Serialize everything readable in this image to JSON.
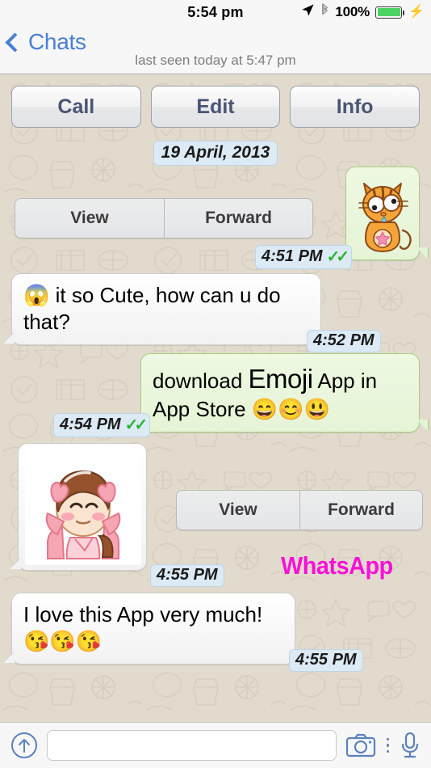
{
  "status_bar": {
    "time": "5:54 pm",
    "battery_percent": "100%",
    "location_icon": "location-arrow-icon",
    "bluetooth_icon": "bluetooth-icon",
    "battery_icon": "battery-full-icon",
    "charging_icon": "charging-bolt-icon",
    "battery_color": "#4cd363"
  },
  "nav": {
    "back_label": "Chats",
    "back_icon": "chevron-left-icon",
    "subtitle": "last seen today at 5:47 pm",
    "accent_color": "#4a7fd4"
  },
  "actions": [
    {
      "label": "Call",
      "name": "call-button"
    },
    {
      "label": "Edit",
      "name": "edit-button"
    },
    {
      "label": "Info",
      "name": "info-button"
    }
  ],
  "date_divider": "19 April, 2013",
  "segmented": {
    "view_label": "View",
    "forward_label": "Forward"
  },
  "messages": [
    {
      "id": "msg-cat-sticker",
      "direction": "outgoing",
      "type": "sticker",
      "sticker": "crying-cat-sticker",
      "time": "4:51 PM",
      "ticks": "✓✓",
      "has_segmented_control": true
    },
    {
      "id": "msg-so-cute",
      "direction": "incoming",
      "type": "text",
      "emoji_lead": "😱",
      "text": "it so Cute, how can u do that?",
      "time": "4:52 PM"
    },
    {
      "id": "msg-download-emoji",
      "direction": "outgoing",
      "type": "text",
      "text_before": "download ",
      "text_big": "Emoji",
      "text_after": " App in App Store ",
      "emoji_tail": "😄😊😃",
      "time": "4:54 PM",
      "ticks": "✓✓"
    },
    {
      "id": "msg-girl-sticker",
      "direction": "incoming",
      "type": "sticker",
      "sticker": "happy-girl-sticker",
      "time": "4:55 PM",
      "has_segmented_control": true
    },
    {
      "id": "msg-love-app",
      "direction": "incoming",
      "type": "text",
      "text": "I love this App very much!",
      "emoji_tail": "😘😘😘",
      "time": "4:55 PM"
    }
  ],
  "watermark": {
    "text": "WhatsApp",
    "color": "#f711d8"
  },
  "input_bar": {
    "placeholder": "",
    "value": "",
    "attach_icon": "upload-arrow-icon",
    "camera_icon": "camera-icon",
    "more_icon": "more-dots-icon",
    "mic_icon": "microphone-icon",
    "accent_color": "#5b82bd"
  }
}
